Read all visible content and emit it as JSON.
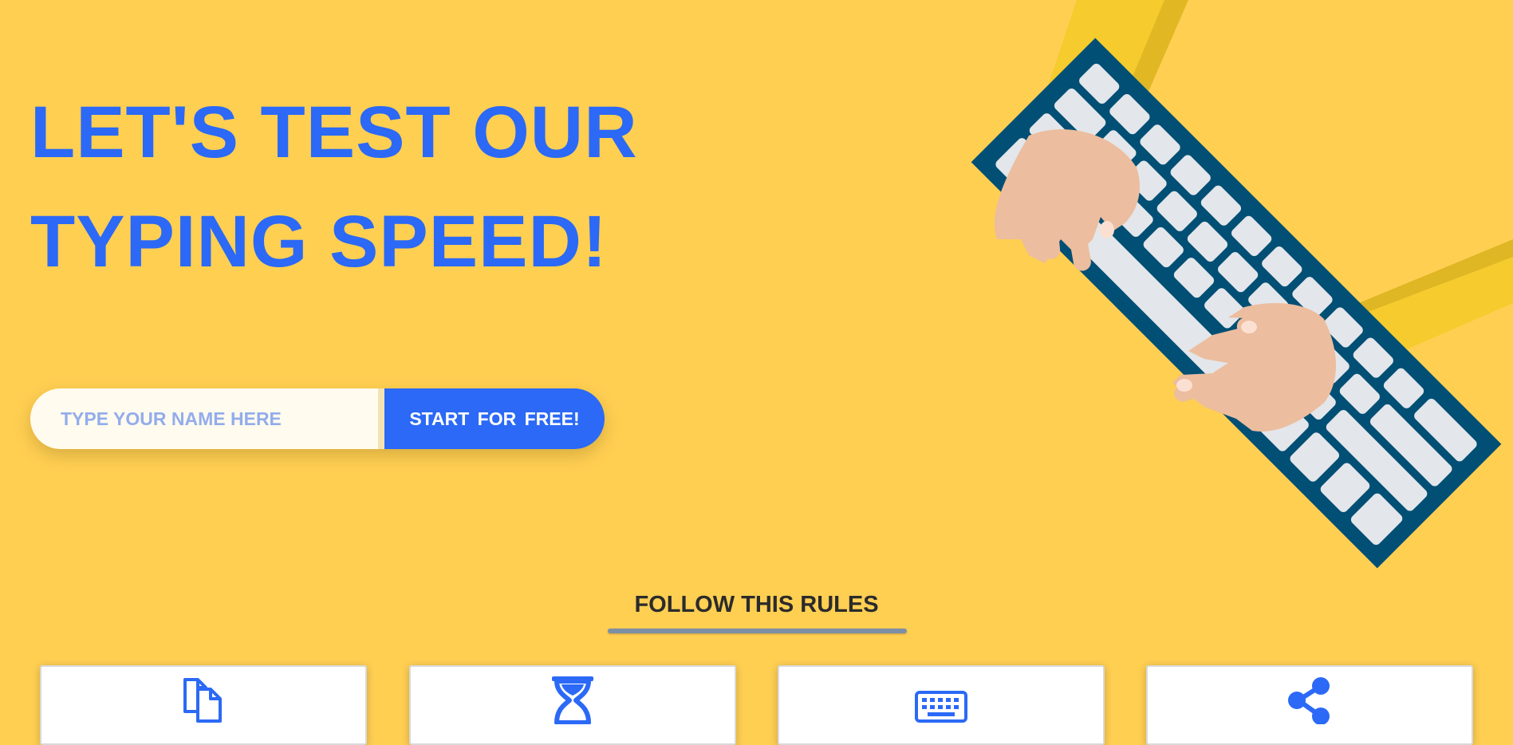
{
  "hero": {
    "title_line_1": "LET'S TEST OUR",
    "title_line_2": "TYPING SPEED!"
  },
  "signup": {
    "name_placeholder": "TYPE YOUR NAME HERE",
    "start_label": "START  FOR  FREE!"
  },
  "illustration": {
    "icon": "hands-typing-on-keyboard-illustration"
  },
  "rules": {
    "heading": "FOLLOW THIS RULES",
    "cards": [
      {
        "icon": "copy-files-icon"
      },
      {
        "icon": "hourglass-icon"
      },
      {
        "icon": "keyboard-icon"
      },
      {
        "icon": "share-icon"
      }
    ]
  },
  "colors": {
    "background": "#ffcf52",
    "accent": "#2b69f6",
    "input_background": "#fffbee",
    "placeholder": "#93acec",
    "heading_text": "#2b2b2b"
  }
}
